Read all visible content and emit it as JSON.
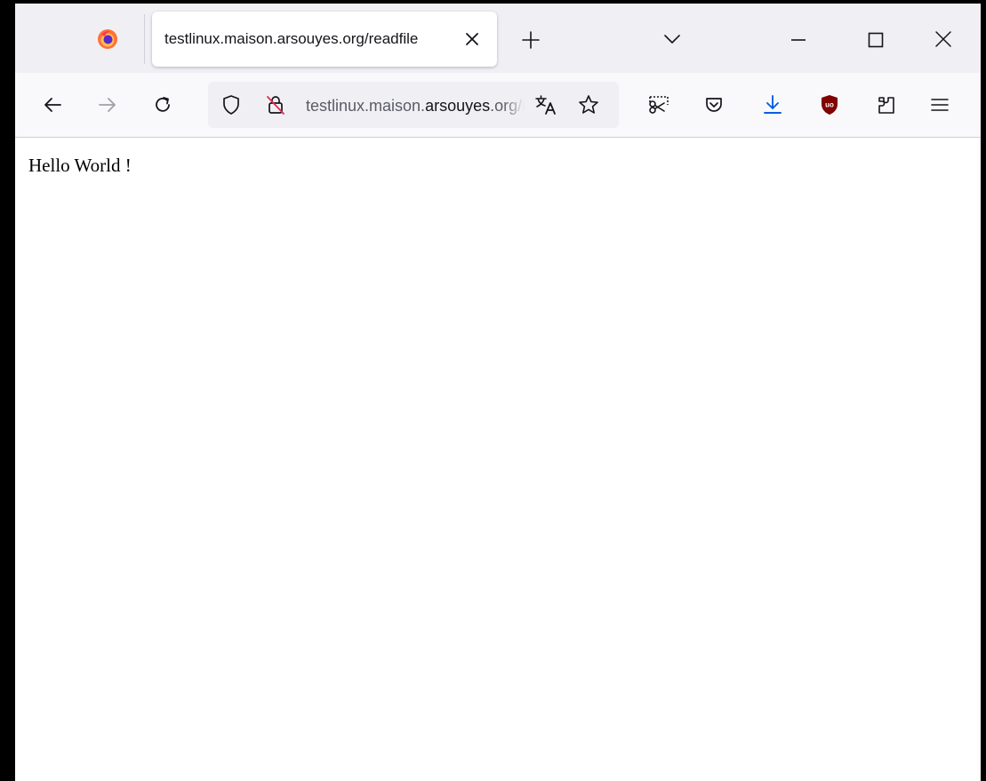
{
  "tab": {
    "title": "testlinux.maison.arsouyes.org/readfile"
  },
  "urlbar": {
    "prefix": "testlinux.maison.",
    "domain": "arsouyes",
    "suffix": ".org/readfile"
  },
  "page": {
    "body_text": "Hello World !"
  },
  "colors": {
    "download_accent": "#0060df",
    "ublock_red": "#800000",
    "insecure_red": "#e22850"
  }
}
